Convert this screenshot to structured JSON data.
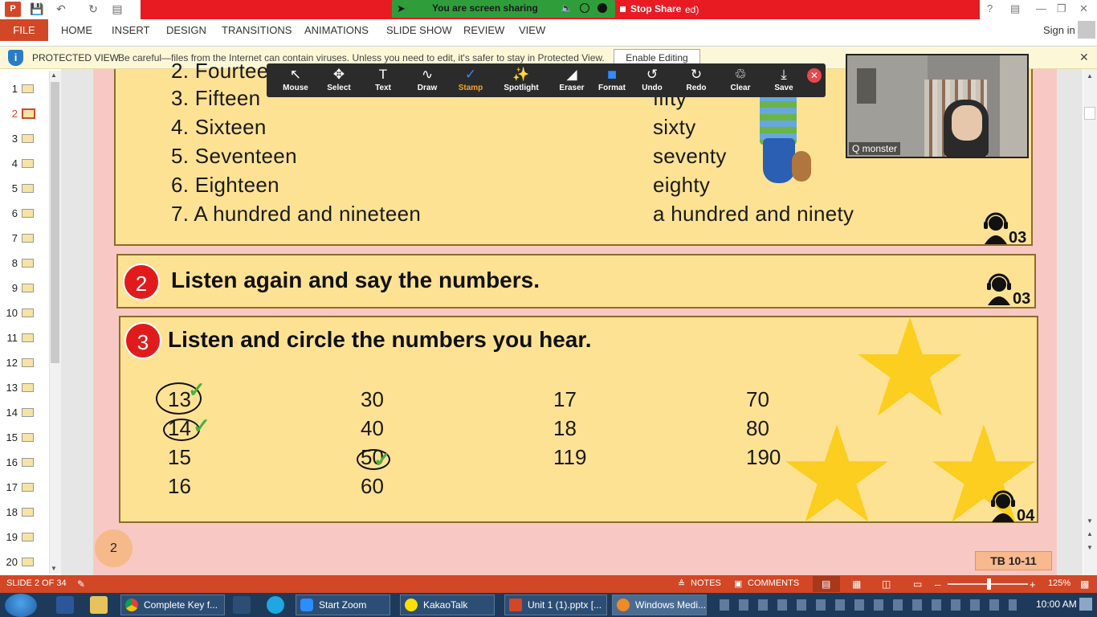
{
  "app": {
    "logo": "P",
    "window_title_fragment": "ed)"
  },
  "zoom_share": {
    "status": "You are screen sharing",
    "stop_label": "Stop Share"
  },
  "ribbon": {
    "file": "FILE",
    "tabs": [
      "HOME",
      "INSERT",
      "DESIGN",
      "TRANSITIONS",
      "ANIMATIONS",
      "SLIDE SHOW",
      "REVIEW",
      "VIEW"
    ],
    "signin": "Sign in"
  },
  "protected_view": {
    "title": "PROTECTED VIEW",
    "message": "Be careful—files from the Internet can contain viruses. Unless you need to edit, it's safer to stay in Protected View.",
    "button": "Enable Editing"
  },
  "thumbnails": [
    "1",
    "2",
    "3",
    "4",
    "5",
    "6",
    "7",
    "8",
    "9",
    "10",
    "11",
    "12",
    "13",
    "14",
    "15",
    "16",
    "17",
    "18",
    "19",
    "20"
  ],
  "selected_slide": "2",
  "zoom_toolbar": [
    {
      "label": "Mouse",
      "icon": "cursor-icon"
    },
    {
      "label": "Select",
      "icon": "move-icon"
    },
    {
      "label": "Text",
      "icon": "text-icon"
    },
    {
      "label": "Draw",
      "icon": "draw-icon"
    },
    {
      "label": "Stamp",
      "icon": "stamp-icon"
    },
    {
      "label": "Spotlight",
      "icon": "spotlight-icon"
    },
    {
      "label": "Eraser",
      "icon": "eraser-icon"
    },
    {
      "label": "Format",
      "icon": "format-icon"
    },
    {
      "label": "Undo",
      "icon": "undo-icon"
    },
    {
      "label": "Redo",
      "icon": "redo-icon"
    },
    {
      "label": "Clear",
      "icon": "trash-icon"
    },
    {
      "label": "Save",
      "icon": "save-icon"
    }
  ],
  "video": {
    "name": "Q monster"
  },
  "slide": {
    "list_partial": "2. Fourtee",
    "list_left": [
      "3. Fifteen",
      "4. Sixteen",
      "5. Seventeen",
      "6. Eighteen",
      "7. A hundred and nineteen"
    ],
    "list_right_partial": "fifty",
    "list_right": [
      "sixty",
      "seventy",
      "eighty",
      "a hundred and ninety"
    ],
    "track1": "03",
    "ex2": {
      "number": "2",
      "title": "Listen again and say the numbers.",
      "track": "03"
    },
    "ex3": {
      "number": "3",
      "title": "Listen and circle the numbers you hear.",
      "track": "04",
      "col1": [
        "13",
        "14",
        "15",
        "16"
      ],
      "col2": [
        "30",
        "40",
        "50",
        "60"
      ],
      "col3": [
        "17",
        "18",
        "119"
      ],
      "col4": [
        "70",
        "80",
        "190"
      ]
    },
    "page_number": "2",
    "tb_label": "TB 10-11"
  },
  "status": {
    "slide_of": "SLIDE 2 OF 34",
    "notes": "NOTES",
    "comments": "COMMENTS",
    "zoom": "125%"
  },
  "taskbar": {
    "items": [
      "Complete Key f...",
      "Start Zoom",
      "KakaoTalk",
      "Unit 1 (1).pptx [...",
      "Windows Medi..."
    ],
    "clock": "10:00 AM"
  },
  "colors": {
    "accent": "#d24726",
    "slide_bg": "#f8c9c4",
    "box": "#fee294",
    "badge": "#e11b1b"
  }
}
